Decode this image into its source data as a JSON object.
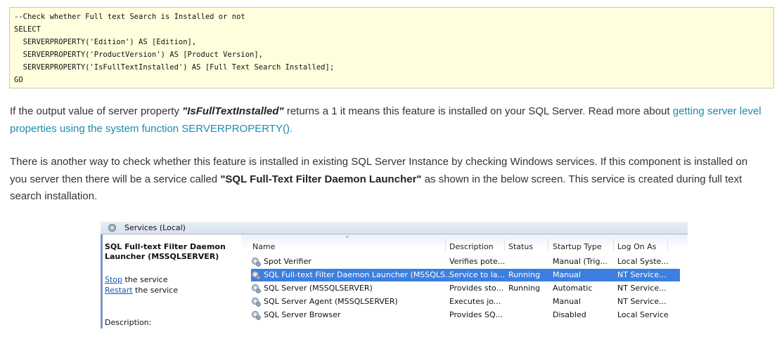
{
  "code": {
    "lines": [
      "--Check whether Full text Search is Installed or not",
      "SELECT",
      "  SERVERPROPERTY('Edition') AS [Edition],",
      "  SERVERPROPERTY('ProductVersion') AS [Product Version],",
      "  SERVERPROPERTY('IsFullTextInstalled') AS [Full Text Search Installed];",
      "GO"
    ]
  },
  "para1": {
    "before": "If the output value of server property ",
    "property": "\"IsFullTextInstalled\"",
    "middle": " returns a 1 it means this feature is installed on your SQL Server. Read more about ",
    "link": "getting server level properties using the system function SERVERPROPERTY()."
  },
  "para2": {
    "before": "There is another way to check whether this feature is installed in existing SQL Server Instance by checking Windows services. If this component is installed on you server then there will be a service called ",
    "service": "\"SQL Full-Text Filter Daemon Launcher\"",
    "after": " as shown in the below screen. This service is created during full text search installation."
  },
  "services": {
    "title": "Services (Local)",
    "left_name": "SQL Full-text Filter Daemon Launcher (MSSQLSERVER)",
    "stop_link": "Stop",
    "stop_rest": " the service",
    "restart_link": "Restart",
    "restart_rest": " the service",
    "description_label": "Description:",
    "columns": {
      "name": "Name",
      "description": "Description",
      "status": "Status",
      "startup": "Startup Type",
      "logon": "Log On As"
    },
    "rows": [
      {
        "name": "Spot Verifier",
        "description": "Verifies pote...",
        "status": "",
        "startup": "Manual (Trig...",
        "logon": "Local Syste..."
      },
      {
        "name": "SQL Full-text Filter Daemon Launcher (MSSQLS...",
        "description": "Service to la...",
        "status": "Running",
        "startup": "Manual",
        "logon": "NT Service..."
      },
      {
        "name": "SQL Server (MSSQLSERVER)",
        "description": "Provides sto...",
        "status": "Running",
        "startup": "Automatic",
        "logon": "NT Service..."
      },
      {
        "name": "SQL Server Agent (MSSQLSERVER)",
        "description": "Executes jo...",
        "status": "",
        "startup": "Manual",
        "logon": "NT Service..."
      },
      {
        "name": "SQL Server Browser",
        "description": "Provides SQ...",
        "status": "",
        "startup": "Disabled",
        "logon": "Local Service"
      }
    ],
    "selected_row": 1
  }
}
